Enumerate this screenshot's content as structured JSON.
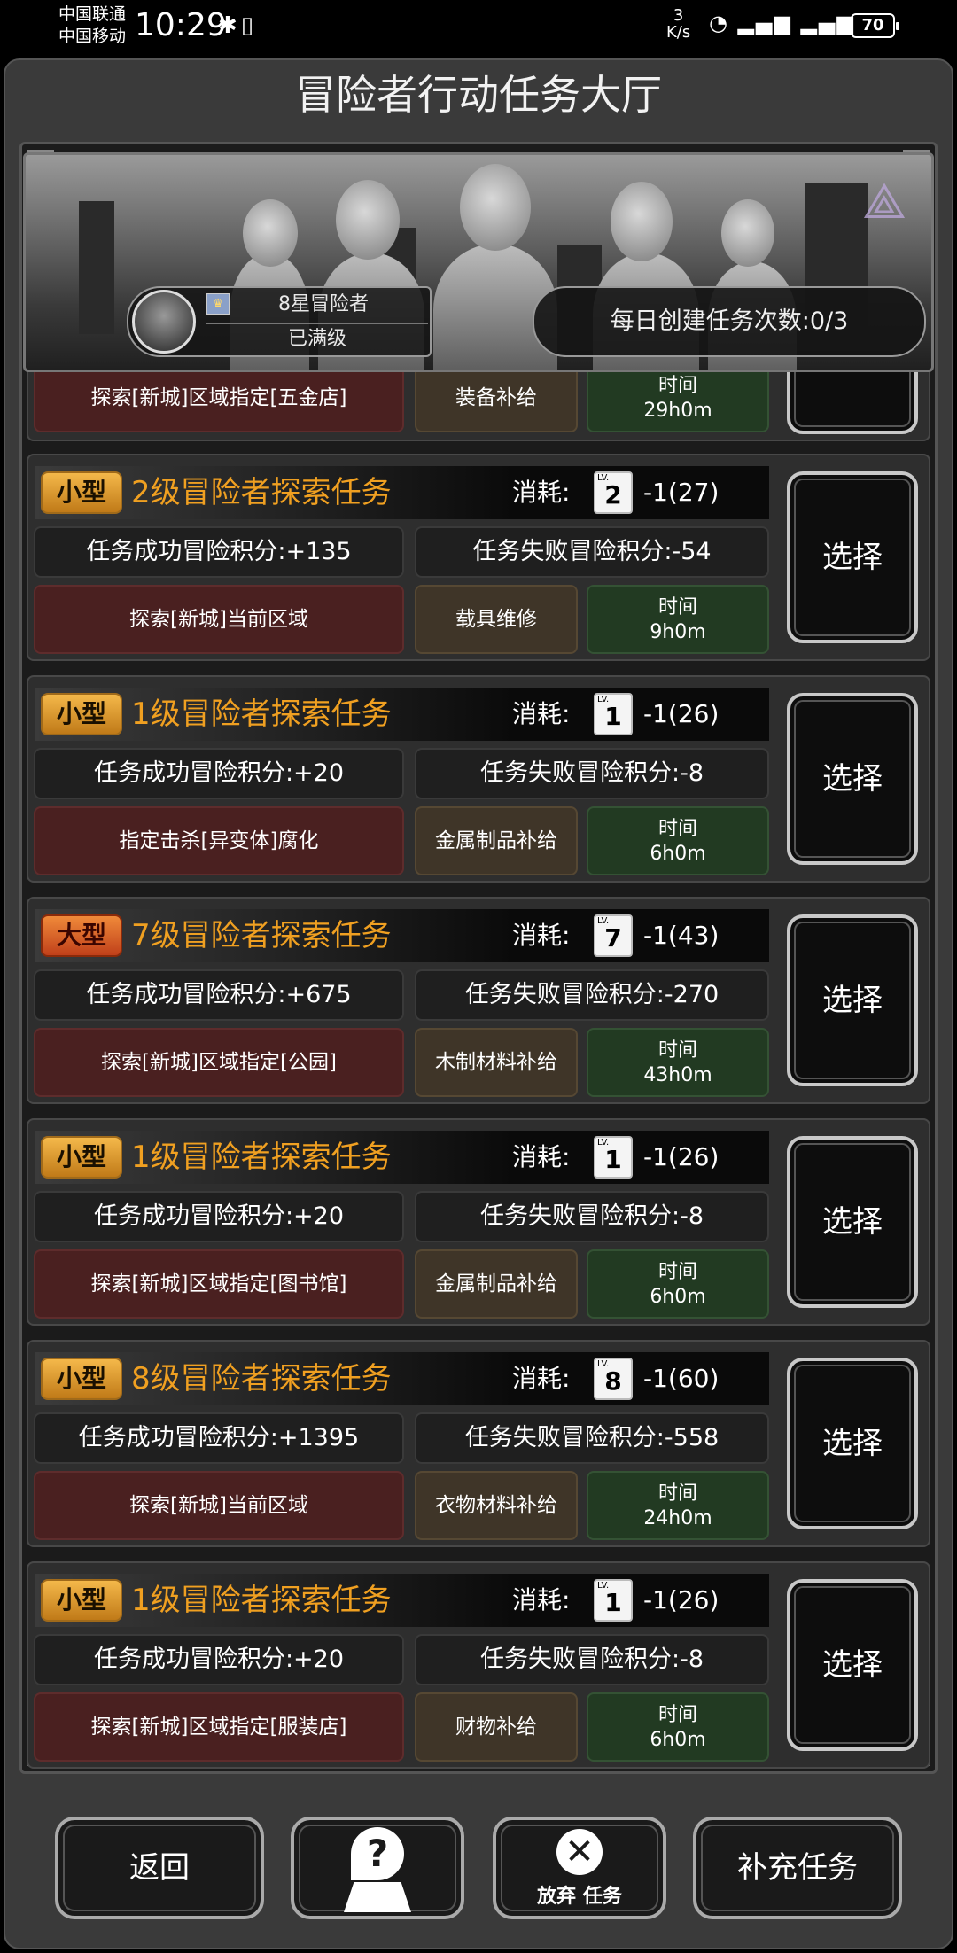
{
  "status_bar": {
    "carrier1": "中国联通",
    "carrier2": "中国移动",
    "time": "10:29",
    "net_speed_value": "3",
    "net_speed_unit": "K/s",
    "battery": "70"
  },
  "title": "冒险者行动任务大厅",
  "banner": {
    "rank_name": "8星冒险者",
    "rank_status": "已满级",
    "daily_create": "每日创建任务次数:0/3"
  },
  "partial_task": {
    "target": "探索[新城]区域指定[五金店]",
    "reward": "装备补给",
    "time_label": "时间",
    "time_value": "29h0m"
  },
  "tasks": [
    {
      "size": "小型",
      "name": "2级冒险者探索任务",
      "cost_label": "消耗:",
      "level": "2",
      "cost": "-1(27)",
      "success": "任务成功冒险积分:+135",
      "fail": "任务失败冒险积分:-54",
      "target": "探索[新城]当前区域",
      "reward": "载具维修",
      "time_label": "时间",
      "time_value": "9h0m",
      "select": "选择"
    },
    {
      "size": "小型",
      "name": "1级冒险者探索任务",
      "cost_label": "消耗:",
      "level": "1",
      "cost": "-1(26)",
      "success": "任务成功冒险积分:+20",
      "fail": "任务失败冒险积分:-8",
      "target": "指定击杀[异变体]腐化",
      "reward": "金属制品补给",
      "time_label": "时间",
      "time_value": "6h0m",
      "select": "选择"
    },
    {
      "size": "大型",
      "name": "7级冒险者探索任务",
      "cost_label": "消耗:",
      "level": "7",
      "cost": "-1(43)",
      "success": "任务成功冒险积分:+675",
      "fail": "任务失败冒险积分:-270",
      "target": "探索[新城]区域指定[公园]",
      "reward": "木制材料补给",
      "time_label": "时间",
      "time_value": "43h0m",
      "select": "选择"
    },
    {
      "size": "小型",
      "name": "1级冒险者探索任务",
      "cost_label": "消耗:",
      "level": "1",
      "cost": "-1(26)",
      "success": "任务成功冒险积分:+20",
      "fail": "任务失败冒险积分:-8",
      "target": "探索[新城]区域指定[图书馆]",
      "reward": "金属制品补给",
      "time_label": "时间",
      "time_value": "6h0m",
      "select": "选择"
    },
    {
      "size": "小型",
      "name": "8级冒险者探索任务",
      "cost_label": "消耗:",
      "level": "8",
      "cost": "-1(60)",
      "success": "任务成功冒险积分:+1395",
      "fail": "任务失败冒险积分:-558",
      "target": "探索[新城]当前区域",
      "reward": "衣物材料补给",
      "time_label": "时间",
      "time_value": "24h0m",
      "select": "选择"
    },
    {
      "size": "小型",
      "name": "1级冒险者探索任务",
      "cost_label": "消耗:",
      "level": "1",
      "cost": "-1(26)",
      "success": "任务成功冒险积分:+20",
      "fail": "任务失败冒险积分:-8",
      "target": "探索[新城]区域指定[服装店]",
      "reward": "财物补给",
      "time_label": "时间",
      "time_value": "6h0m",
      "select": "选择"
    }
  ],
  "bottom": {
    "back": "返回",
    "help_icon": "question-map-icon",
    "abandon_text": "放弃 任务",
    "replenish": "补充任务"
  },
  "colors": {
    "task_title": "#f0a021",
    "small_tag": "#f4b84a",
    "big_tag": "#f08a3a"
  }
}
